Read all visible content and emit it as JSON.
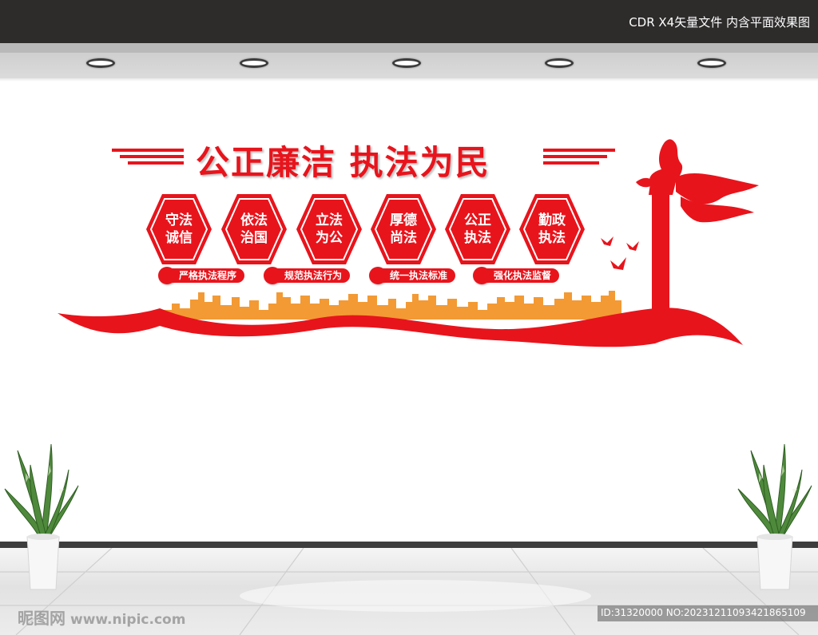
{
  "header": {
    "text": "CDR X4矢量文件  内含平面效果图"
  },
  "banner": {
    "title": "公正廉洁 执法为民",
    "hexagons": [
      {
        "line1": "守法",
        "line2": "诚信"
      },
      {
        "line1": "依法",
        "line2": "治国"
      },
      {
        "line1": "立法",
        "line2": "为公"
      },
      {
        "line1": "厚德",
        "line2": "尚法"
      },
      {
        "line1": "公正",
        "line2": "执法"
      },
      {
        "line1": "勤政",
        "line2": "执法"
      }
    ],
    "slogans": [
      "严格执法程序",
      "规范执法行为",
      "统一执法标准",
      "强化执法监督"
    ]
  },
  "watermark": {
    "site": "昵图网",
    "url": "www.nipic.com"
  },
  "image_id": "ID:31320000 NO:20231211093421865109",
  "colors": {
    "primary_red": "#e8141c",
    "skyline_orange": "#f39a34",
    "topbar": "#2e2b2b"
  }
}
